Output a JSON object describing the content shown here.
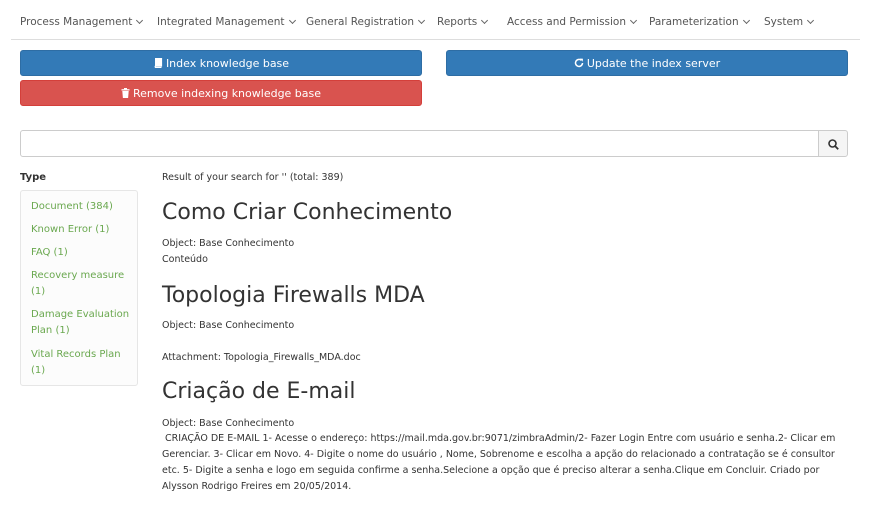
{
  "nav": {
    "items": [
      {
        "label": "Process Management"
      },
      {
        "label": "Integrated Management"
      },
      {
        "label": "General Registration"
      },
      {
        "label": "Reports"
      },
      {
        "label": "Access and Permission"
      },
      {
        "label": "Parameterization"
      },
      {
        "label": "System"
      }
    ]
  },
  "actions": {
    "index_label": "Index knowledge base",
    "update_label": "Update the index server",
    "remove_label": "Remove indexing knowledge base",
    "index_icon": "book-icon",
    "update_icon": "refresh-icon",
    "remove_icon": "trash-icon",
    "primary_color": "#337ab7",
    "danger_color": "#d9534f"
  },
  "search": {
    "value": "",
    "placeholder": "",
    "button_icon": "search-icon"
  },
  "facets": {
    "title": "Type",
    "items": [
      {
        "line1": "Document (384)",
        "line2": ""
      },
      {
        "line1": "Known Error (1)",
        "line2": ""
      },
      {
        "line1": "FAQ (1)",
        "line2": ""
      },
      {
        "line1": "Recovery measure",
        "line2": "(1)"
      },
      {
        "line1": "Damage Evaluation",
        "line2": "Plan (1)"
      },
      {
        "line1": "Vital Records Plan",
        "line2": "(1)"
      }
    ],
    "link_color": "#6aa84f"
  },
  "results": {
    "summary": "Result of your search for '' (total: 389)",
    "items": [
      {
        "title": "Como Criar Conhecimento",
        "object": "Object: Base Conhecimento",
        "body": "Conteúdo"
      },
      {
        "title": "Topologia Firewalls MDA",
        "object": "Object: Base Conhecimento",
        "attachment": "Attachment: Topologia_Firewalls_MDA.doc"
      },
      {
        "title": "Criação de E-mail",
        "object": "Object: Base Conhecimento",
        "body": " CRIAÇÃO DE E-MAIL 1- Acesse o endereço: https://mail.mda.gov.br:9071/zimbraAdmin/2- Fazer Login Entre com usuário e senha.2- Clicar em Gerenciar. 3- Clicar em Novo. 4- Digite o nome do usuário , Nome, Sobrenome e escolha a apção do relacionado a contratação se é consultor etc. 5- Digite a senha e logo em seguida confirme a senha.Selecione a opção que é preciso alterar a senha.Clique em Concluir. Criado por Alysson Rodrigo Freires em 20/05/2014."
      }
    ]
  }
}
